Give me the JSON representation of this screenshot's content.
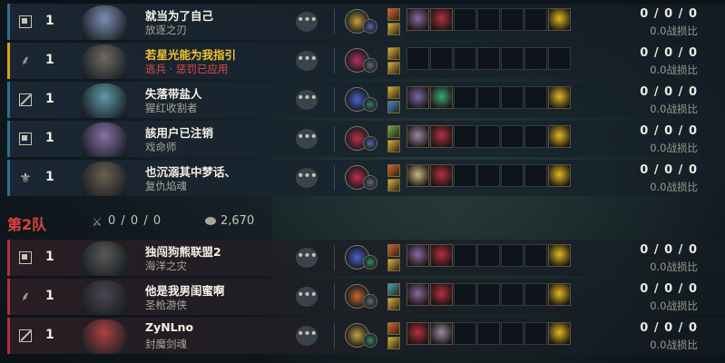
{
  "team1": {
    "rows": [
      {
        "role": "top",
        "level": "1",
        "name": "就当为了自己",
        "champion": "放逐之刃",
        "name_color": "white",
        "champ_color": "gray",
        "accent": "blue",
        "face": "#7c8fb1",
        "keystone": "#c9a23a",
        "subrune": "#5c6aa8",
        "spells": [
          "#d8652b",
          "#d9b23a"
        ],
        "items": [
          {
            "c": "#8a6aa0"
          },
          {
            "c": "#b23040"
          },
          null,
          null,
          null,
          null,
          {
            "c": "#e0b820"
          }
        ],
        "kda": "0 / 0 / 0",
        "kdr": "0.0战损比"
      },
      {
        "role": "jungle",
        "level": "1",
        "name": "若星光能为我指引",
        "champion": "逃兵 · 惩罚已应用",
        "name_color": "gold",
        "champ_color": "red",
        "accent": "gold",
        "face": "#6e6a60",
        "keystone": "#b83060",
        "subrune": "#6a6a70",
        "spells": [
          "#d9b23a",
          "#d9b23a"
        ],
        "items": [
          null,
          null,
          null,
          null,
          null,
          null,
          null
        ],
        "kda": "0 / 0 / 0",
        "kdr": "0.0战损比"
      },
      {
        "role": "mid",
        "level": "1",
        "name": "失落带盐人",
        "champion": "猩红收割者",
        "name_color": "white",
        "champ_color": "gray",
        "accent": "blue",
        "face": "#5e9aa8",
        "keystone": "#4a62c8",
        "subrune": "#3d7a6a",
        "spells": [
          "#d9b23a",
          "#3a8ad0"
        ],
        "items": [
          {
            "c": "#7a68a8"
          },
          {
            "c": "#3aa878"
          },
          null,
          null,
          null,
          null,
          {
            "c": "#e0b820"
          }
        ],
        "kda": "0 / 0 / 0",
        "kdr": "0.0战损比"
      },
      {
        "role": "top",
        "level": "1",
        "name": "該用户已注销",
        "champion": "戏命师",
        "name_color": "white",
        "champ_color": "gray",
        "accent": "blue",
        "face": "#8a70a8",
        "keystone": "#c0304a",
        "subrune": "#5a6aa0",
        "spells": [
          "#6ab04a",
          "#d9b23a"
        ],
        "items": [
          {
            "c": "#9a8aa0"
          },
          {
            "c": "#b23040"
          },
          null,
          null,
          null,
          null,
          {
            "c": "#e0b820"
          }
        ],
        "kda": "0 / 0 / 0",
        "kdr": "0.0战损比"
      },
      {
        "role": "support",
        "level": "1",
        "name": "也沉溺其中梦话、",
        "champion": "复仇焰魂",
        "name_color": "white",
        "champ_color": "gray",
        "accent": "blue",
        "face": "#6a6050",
        "keystone": "#c0304a",
        "subrune": "#6a6a70",
        "spells": [
          "#d8652b",
          "#d9b23a"
        ],
        "items": [
          {
            "c": "#c8b888"
          },
          {
            "c": "#b23040"
          },
          null,
          null,
          null,
          null,
          {
            "c": "#e0b820"
          }
        ],
        "kda": "0 / 0 / 0",
        "kdr": "0.0战损比"
      }
    ]
  },
  "team2": {
    "title": "第2队",
    "kda": "0 / 0 / 0",
    "gold": "2,670",
    "rows": [
      {
        "role": "top",
        "level": "1",
        "name": "独闯狗熊联盟2",
        "champion": "海洋之灾",
        "name_color": "white",
        "champ_color": "gray",
        "accent": "red",
        "face": "#5a5a52",
        "keystone": "#4a62c8",
        "subrune": "#3d8a5a",
        "spells": [
          "#d8652b",
          "#d9b23a"
        ],
        "items": [
          {
            "c": "#8a6aa0"
          },
          {
            "c": "#b23040"
          },
          null,
          null,
          null,
          null,
          {
            "c": "#e0b820"
          }
        ],
        "kda": "0 / 0 / 0",
        "kdr": "0.0战损比"
      },
      {
        "role": "jungle",
        "level": "1",
        "name": "他是我男闺蜜啊",
        "champion": "圣枪游侠",
        "name_color": "white",
        "champ_color": "gray",
        "accent": "red",
        "face": "#4a4650",
        "keystone": "#c86a2a",
        "subrune": "#6a6a70",
        "spells": [
          "#3aa8c0",
          "#d9b23a"
        ],
        "items": [
          {
            "c": "#8a6aa0"
          },
          {
            "c": "#b23040"
          },
          null,
          null,
          null,
          null,
          {
            "c": "#e0b820"
          }
        ],
        "kda": "0 / 0 / 0",
        "kdr": "0.0战损比"
      },
      {
        "role": "mid",
        "level": "1",
        "name": "ZyNLno",
        "champion": "封魔剑魂",
        "name_color": "white",
        "champ_color": "gray",
        "accent": "red",
        "face": "#b04040",
        "keystone": "#c9a23a",
        "subrune": "#3d8a5a",
        "spells": [
          "#d8652b",
          "#d9b23a"
        ],
        "items": [
          {
            "c": "#b23040"
          },
          {
            "c": "#9a8aa0"
          },
          null,
          null,
          null,
          null,
          {
            "c": "#e0b820"
          }
        ],
        "kda": "0 / 0 / 0",
        "kdr": "0.0战损比"
      }
    ]
  }
}
